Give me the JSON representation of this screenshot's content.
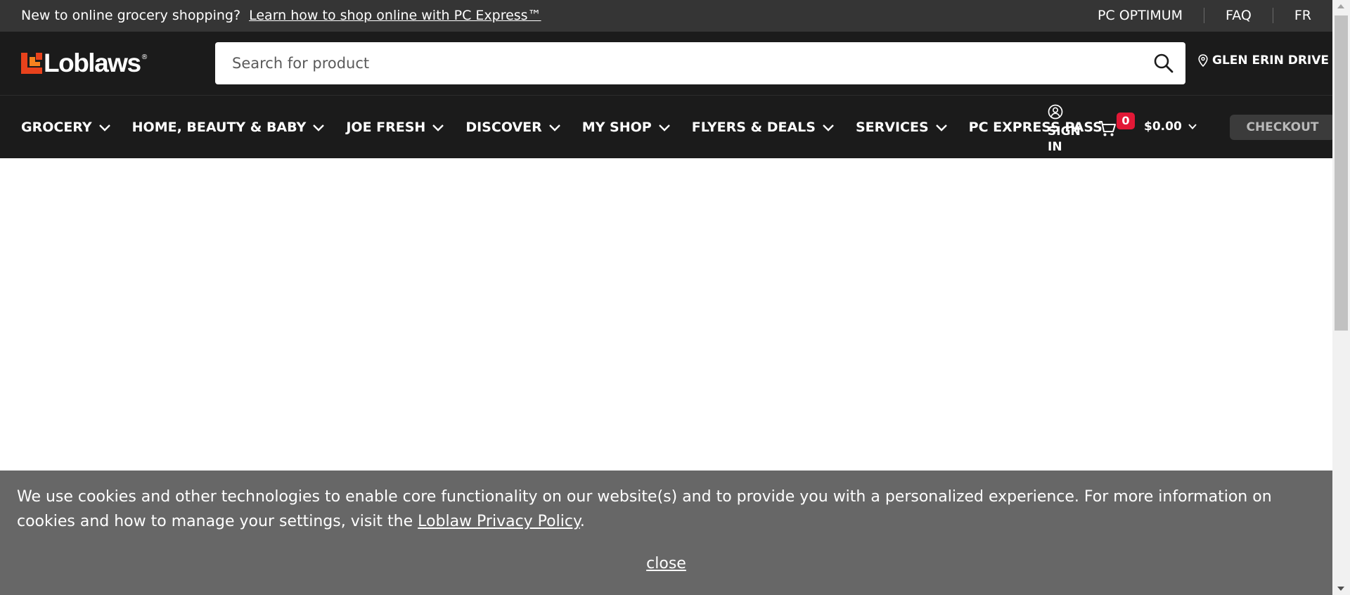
{
  "topbar": {
    "promo_text": "New to online grocery shopping?",
    "promo_link": "Learn how to shop online with PC Express™",
    "links": [
      "PC OPTIMUM",
      "FAQ",
      "FR"
    ]
  },
  "header": {
    "logo_text": "Loblaws",
    "logo_reg": "®",
    "search_placeholder": "Search for product",
    "store_name": "GLEN ERIN DRIVE"
  },
  "nav": {
    "items": [
      {
        "label": "GROCERY"
      },
      {
        "label": "HOME, BEAUTY & BABY"
      },
      {
        "label": "JOE FRESH"
      },
      {
        "label": "DISCOVER"
      },
      {
        "label": "MY SHOP"
      },
      {
        "label": "FLYERS & DEALS"
      },
      {
        "label": "SERVICES"
      },
      {
        "label": "PC EXPRESS PASS"
      }
    ],
    "signin_line1": "SIGN",
    "signin_line2": "IN",
    "cart_count": "0",
    "cart_total": "$0.00",
    "checkout_label": "CHECKOUT"
  },
  "cookie": {
    "message_before": "We use cookies and other technologies to enable core functionality on our website(s) and to provide you with a personalized experience. For more information on cookies and how to manage your settings, visit the ",
    "policy_link": "Loblaw Privacy Policy",
    "message_after": ".",
    "close_label": "close"
  },
  "colors": {
    "topbar_bg": "#353535",
    "header_bg": "#1b1b1b",
    "brand_orange": "#e8421c",
    "cart_badge": "#e21836",
    "cookie_bg": "#676767"
  },
  "icons": {
    "search": "search-icon",
    "store": "map-pin-icon",
    "nav_dropdown": "chevron-down-icon",
    "signin": "user-circle-icon",
    "cart": "cart-icon"
  }
}
